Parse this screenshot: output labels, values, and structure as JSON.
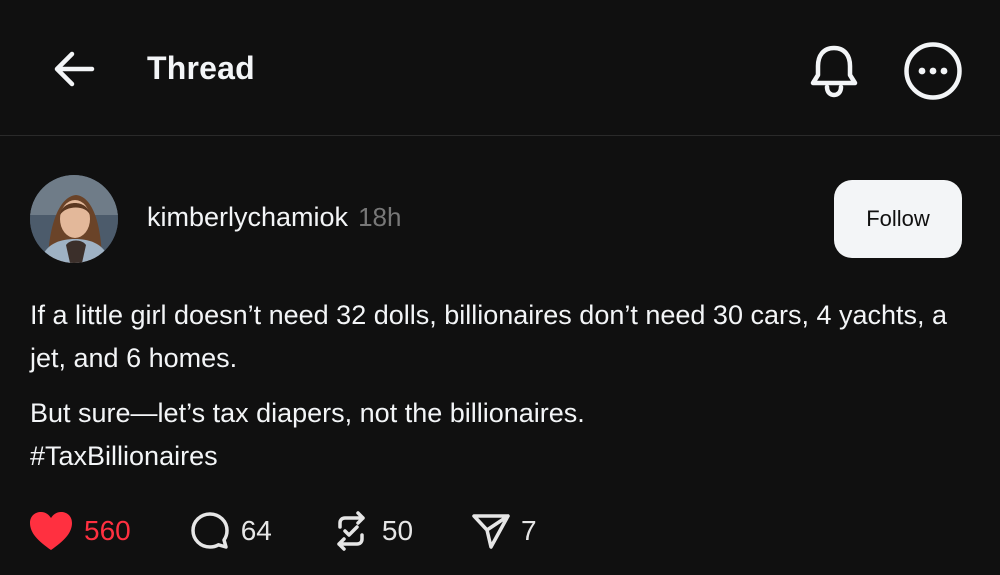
{
  "header": {
    "title": "Thread",
    "back_icon": "arrow-left-icon",
    "notify_icon": "bell-icon",
    "more_icon": "more-horizontal-icon"
  },
  "post": {
    "username": "kimberlychamiok",
    "time": "18h",
    "follow_label": "Follow",
    "paragraphs": [
      "If a little girl doesn’t need 32 dolls, billionaires don’t need 30 cars, 4 yachts, a jet, and 6 homes.",
      "But sure—let’s tax diapers, not the billionaires.",
      "#TaxBillionaires"
    ],
    "actions": {
      "likes": "560",
      "replies": "64",
      "reposts": "50",
      "shares": "7"
    }
  },
  "colors": {
    "background": "#101010",
    "text": "#f3f5f7",
    "muted": "#777777",
    "like": "#ff3040",
    "follow_bg": "#f3f5f7"
  }
}
